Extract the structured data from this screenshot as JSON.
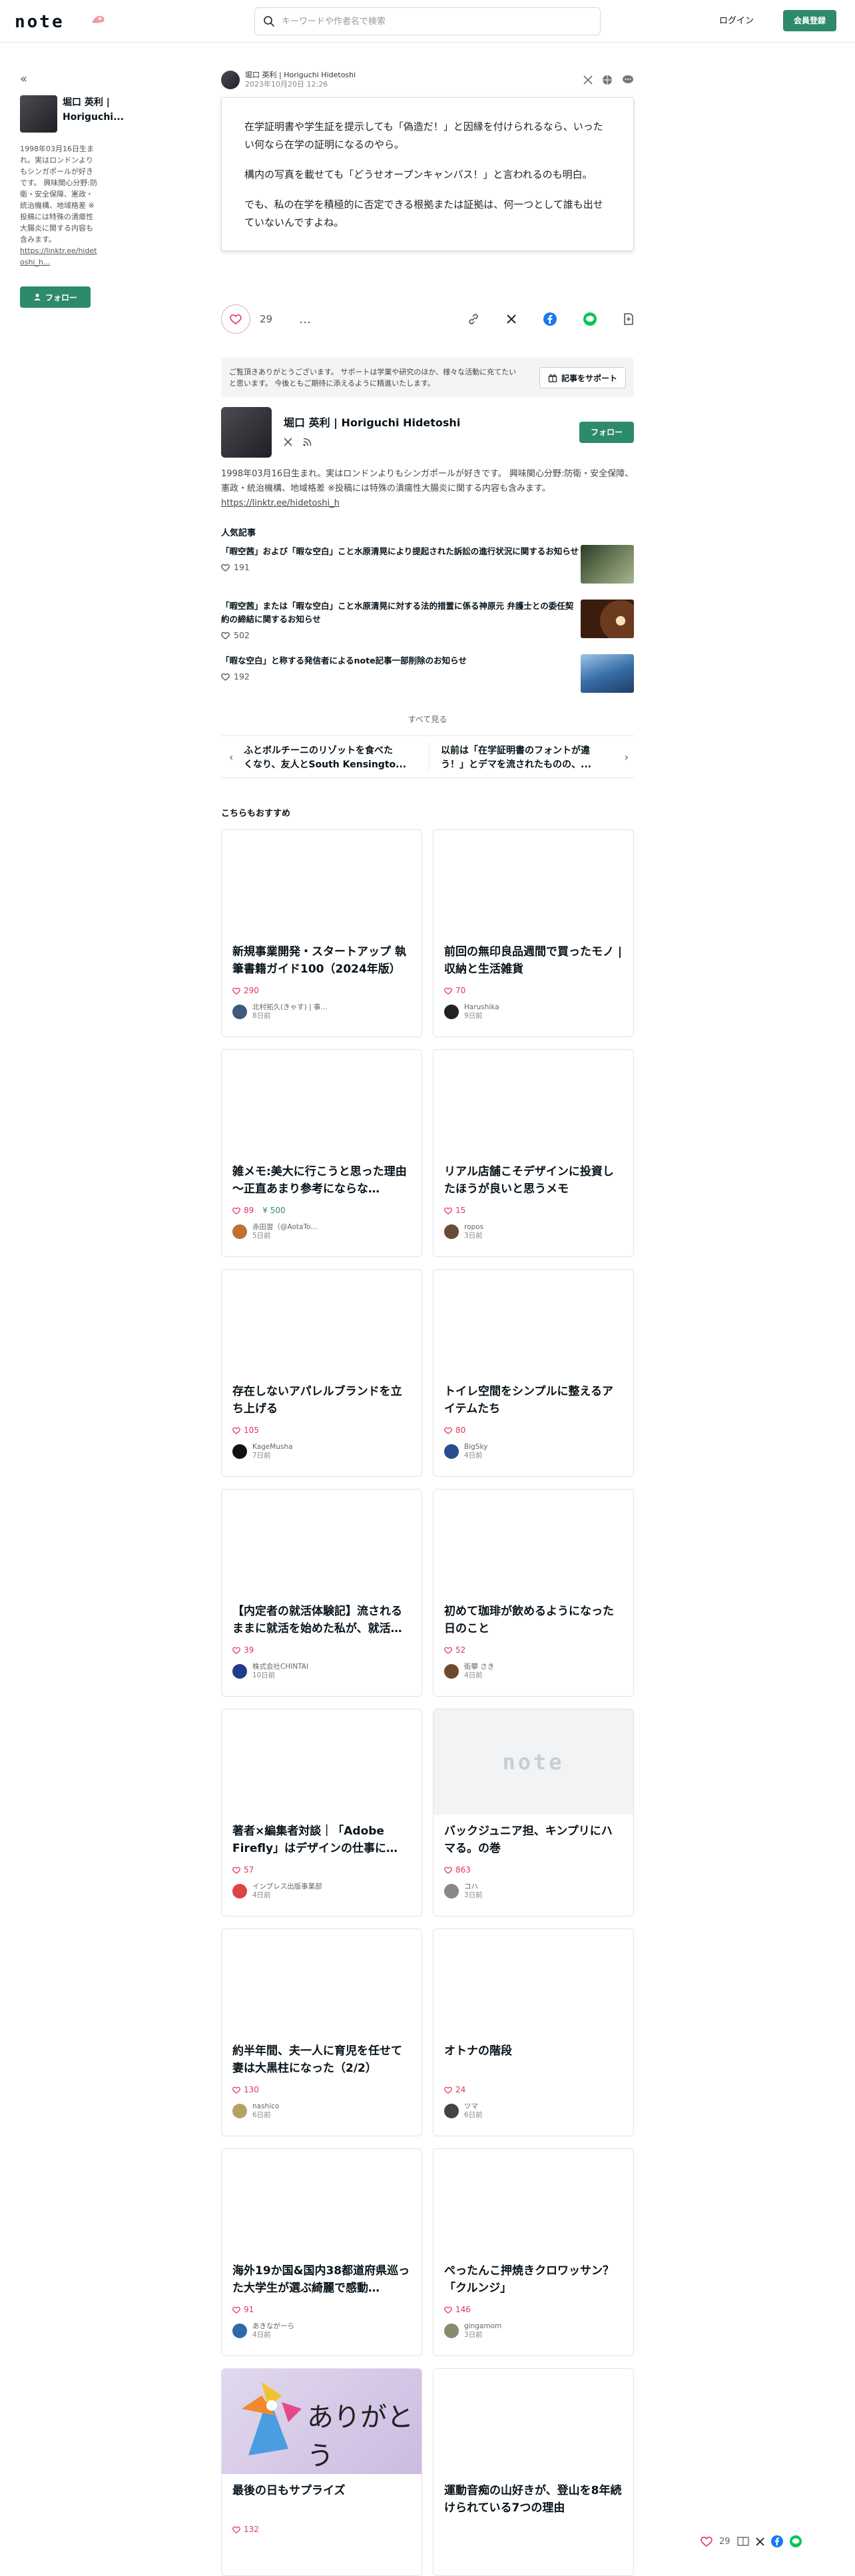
{
  "header": {
    "logo": "note",
    "search_placeholder": "キーワードや作者名で検索",
    "login": "ログイン",
    "signup": "会員登録"
  },
  "sidebar": {
    "name": "堀口 英利 | Horiguchi...",
    "bio": "1998年03月16日生まれ。実はロンドンよりもシンガポールが好きです。 興味関心分野:防衛・安全保障、憲政・統治機構、地域格差 ※投稿には特殊の潰瘍性大腸炎に関する内容も含みます。",
    "link": "https://linktr.ee/hidetoshi_h...",
    "follow": "フォロー"
  },
  "embed": {
    "author": "堀口 英利 | Horiguchi Hidetoshi",
    "date": "2023年10月20日 12:26",
    "paragraphs": [
      "在学証明書や学生証を提示しても「偽造だ！」と因縁を付けられるなら、いったい何なら在学の証明になるのやら。",
      "構内の写真を載せても「どうせオープンキャンパス！」と言われるのも明白。",
      "でも、私の在学を積極的に否定できる根拠または証拠は、何一つとして誰も出せていないんですよね。"
    ]
  },
  "actions": {
    "like_count": "29",
    "more": "…"
  },
  "support": {
    "text": "ご覧頂きありがとうございます。 サポートは学業や研究のほか、様々な活動に充てたいと思います。 今後ともご期待に添えるように精進いたします。",
    "button": "記事をサポート"
  },
  "author": {
    "name": "堀口 英利 | Horiguchi Hidetoshi",
    "follow": "フォロー",
    "bio": "1998年03月16日生まれ。実はロンドンよりもシンガポールが好きです。 興味関心分野:防衛・安全保障、憲政・統治機構、地域格差 ※投稿には特殊の潰瘍性大腸炎に関する内容も含みます。",
    "link": "https://linktr.ee/hidetoshi_h"
  },
  "popular": {
    "title": "人気記事",
    "items": [
      {
        "title": "「暇空茜」および「暇な空白」こと水原清晃により提起された訴訟の進行状況に関するお知らせ",
        "likes": "191"
      },
      {
        "title": "「暇空茜」または「暇な空白」こと水原清晃に対する法的措置に係る神原元 弁護士との委任契約の締結に関するお知らせ",
        "likes": "502"
      },
      {
        "title": "「暇な空白」と称する発信者によるnote記事一部削除のお知らせ",
        "likes": "192"
      }
    ],
    "see_all": "すべて見る"
  },
  "nav": {
    "prev_line1": "ふとボルチーニのリゾットを食べた",
    "prev_line2": "くなり、友人とSouth Kensingto...",
    "next_line1": "以前は「在学証明書のフォントが違",
    "next_line2": "う！」とデマを流されたものの、..."
  },
  "recommend": {
    "title": "こちらもおすすめ",
    "cards": [
      {
        "title": "新規事業開発・スタートアップ 執筆書籍ガイド100（2024年版）",
        "likes": "290",
        "price": "",
        "author": "北村拓久(きゃす) | 事…",
        "date": "8日前"
      },
      {
        "title": "前回の無印良品週間で買ったモノ | 収納と生活雑貨",
        "likes": "70",
        "price": "",
        "author": "Harushika",
        "date": "9日前"
      },
      {
        "title": "雑メモ:美大に行こうと思った理由 〜正直あまり参考にならな…",
        "likes": "89",
        "price": "¥ 500",
        "author": "赤田習（@AotaTo…",
        "date": "5日前"
      },
      {
        "title": "リアル店舗こそデザインに投資したほうが良いと思うメモ",
        "likes": "15",
        "price": "",
        "author": "ropos",
        "date": "3日前"
      },
      {
        "title": "存在しないアパレルブランドを立ち上げる",
        "likes": "105",
        "price": "",
        "author": "KageMusha",
        "date": "7日前"
      },
      {
        "title": "トイレ空間をシンプルに整えるアイテムたち",
        "likes": "80",
        "price": "",
        "author": "BigSky",
        "date": "4日前"
      },
      {
        "title": "【内定者の就活体験記】流されるままに就活を始めた私が、就活…",
        "likes": "39",
        "price": "",
        "author": "株式会社CHINTAI",
        "date": "10日前"
      },
      {
        "title": "初めて珈琲が飲めるようになった日のこと",
        "likes": "52",
        "price": "",
        "author": "街攀 さき",
        "date": "4日前"
      },
      {
        "title": "著者×編集者対談｜「Adobe Firefly」はデザインの仕事に…",
        "likes": "57",
        "price": "",
        "author": "インプレス出版事業部",
        "date": "4日前"
      },
      {
        "title": "バックジュニア担、キンプリにハマる。の巻",
        "likes": "863",
        "price": "",
        "author": "コハ",
        "date": "3日前"
      },
      {
        "title": "約半年間、夫一人に育児を任せて妻は大黒柱になった（2/2）",
        "likes": "130",
        "price": "",
        "author": "nashico",
        "date": "6日前"
      },
      {
        "title": "オトナの階段",
        "likes": "24",
        "price": "",
        "author": "ツマ",
        "date": "6日前"
      },
      {
        "title": "海外19か国&国内38都道府県巡った大学生が選ぶ綺麗で感動…",
        "likes": "91",
        "price": "",
        "author": "あきながーら",
        "date": "4日前"
      },
      {
        "title": "ぺったんこ押焼きクロワッサン？「クルンジ」",
        "likes": "146",
        "price": "",
        "author": "gingamom",
        "date": "3日前"
      },
      {
        "title": "最後の日もサプライズ",
        "likes": "132",
        "price": "",
        "author": "",
        "date": ""
      },
      {
        "title": "運動音痴の山好きが、登山を8年続けられている7つの理由",
        "likes": "",
        "price": "",
        "author": "",
        "date": ""
      }
    ],
    "thumb_text_arigatou": "ありがとう",
    "thumb_note": "note"
  },
  "floatbar": {
    "like_count": "29"
  },
  "colors": {
    "brand_green": "#2d8a6b",
    "like_red": "#e0365a"
  }
}
